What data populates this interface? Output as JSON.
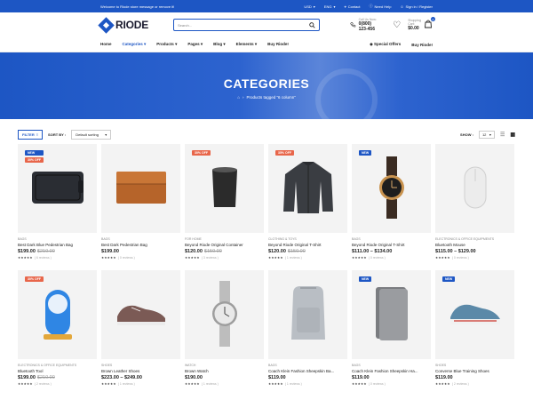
{
  "topbar": {
    "welcome": "Welcome to Riode store message or remove it!",
    "currency": "USD",
    "language": "ENG",
    "contact": "Contact",
    "help": "Need Help",
    "signin": "Sign in / Register"
  },
  "header": {
    "logo": "RIODE",
    "search_placeholder": "Search...",
    "call_label": "Call Us Now:",
    "call_number": "0(800) 123-456",
    "cart_label": "Shopping Cart:",
    "cart_amount": "$0.00",
    "cart_count": "0"
  },
  "nav": {
    "items": [
      "Home",
      "Categories",
      "Products",
      "Pages",
      "Blog",
      "Elements",
      "Buy Riode!"
    ],
    "special": "Special Offers",
    "buy": "Buy Riode!"
  },
  "hero": {
    "title": "CATEGORIES",
    "breadcrumb": "Products tagged “6 column”"
  },
  "toolbar": {
    "filter": "FILTER",
    "sort_label": "SORT BY :",
    "sort_value": "Default sorting",
    "show_label": "SHOW :",
    "show_value": "12"
  },
  "products": [
    {
      "badges": [
        {
          "t": "NEW",
          "c": "new"
        },
        {
          "t": "30% OFF",
          "c": "off"
        }
      ],
      "cat": "BAGS",
      "name": "Best Dark Blue Pedestrian Bag",
      "price": "$199.00",
      "old": "$210.00",
      "reviews": "( 6 reviews )",
      "art": "bag-dark"
    },
    {
      "badges": [],
      "cat": "BAGS",
      "name": "Best Dark Pedestrian Bag",
      "price": "$199.00",
      "old": "",
      "reviews": "( 0 reviews )",
      "art": "bag-brown"
    },
    {
      "badges": [
        {
          "t": "30% OFF",
          "c": "off"
        }
      ],
      "cat": "FOR HOME",
      "name": "Beyond Riode Original Container",
      "price": "$120.00",
      "old": "$150.00",
      "reviews": "( 3 reviews )",
      "art": "cup"
    },
    {
      "badges": [
        {
          "t": "35% OFF",
          "c": "off"
        }
      ],
      "cat": "CLOTHING & TOYS",
      "name": "Beyond Riode Original T-Shirt",
      "price": "$120.00",
      "old": "$150.00",
      "reviews": "( 1 reviews )",
      "art": "jacket"
    },
    {
      "badges": [
        {
          "t": "NEW",
          "c": "new"
        }
      ],
      "cat": "BAGS",
      "name": "Beyond Riode Original T-Shirt",
      "price": "$111.00 – $134.00",
      "old": "",
      "reviews": "( 0 reviews )",
      "art": "watch-gold"
    },
    {
      "badges": [],
      "cat": "ELECTRONICS & OFFICE EQUIPMENTS",
      "name": "Bluetooth Mouse",
      "price": "$115.00 – $129.00",
      "old": "",
      "reviews": "( 0 reviews )",
      "art": "mouse"
    },
    {
      "badges": [
        {
          "t": "30% OFF",
          "c": "off"
        }
      ],
      "cat": "ELECTRONICS & OFFICE EQUIPMENTS",
      "name": "Bluetooth Tool",
      "price": "$199.00",
      "old": "$210.00",
      "reviews": "( 2 reviews )",
      "art": "speaker"
    },
    {
      "badges": [],
      "cat": "SHOES",
      "name": "Brown Leather Shoes",
      "price": "$223.00 – $249.00",
      "old": "",
      "reviews": "( 1 reviews )",
      "art": "shoe-brown"
    },
    {
      "badges": [],
      "cat": "WATCH",
      "name": "Brown Watch",
      "price": "$190.00",
      "old": "",
      "reviews": "( 1 reviews )",
      "art": "watch-gray"
    },
    {
      "badges": [],
      "cat": "BAGS",
      "name": "Coach Klein Fashion Sheepskin Ba...",
      "price": "$119.00",
      "old": "",
      "reviews": "( 1 reviews )",
      "art": "backpack"
    },
    {
      "badges": [
        {
          "t": "NEW",
          "c": "new"
        }
      ],
      "cat": "BAGS",
      "name": "Coach Klein Fashion Sheepskin Ha...",
      "price": "$119.00",
      "old": "",
      "reviews": "( 0 reviews )",
      "art": "folder"
    },
    {
      "badges": [
        {
          "t": "NEW",
          "c": "new"
        }
      ],
      "cat": "SHOES",
      "name": "Converse Blue Training Shoes",
      "price": "$119.00",
      "old": "",
      "reviews": "( 2 reviews )",
      "art": "shoe-blue"
    }
  ],
  "colors": {
    "accent": "#1d56c4",
    "sale": "#e8664a"
  }
}
